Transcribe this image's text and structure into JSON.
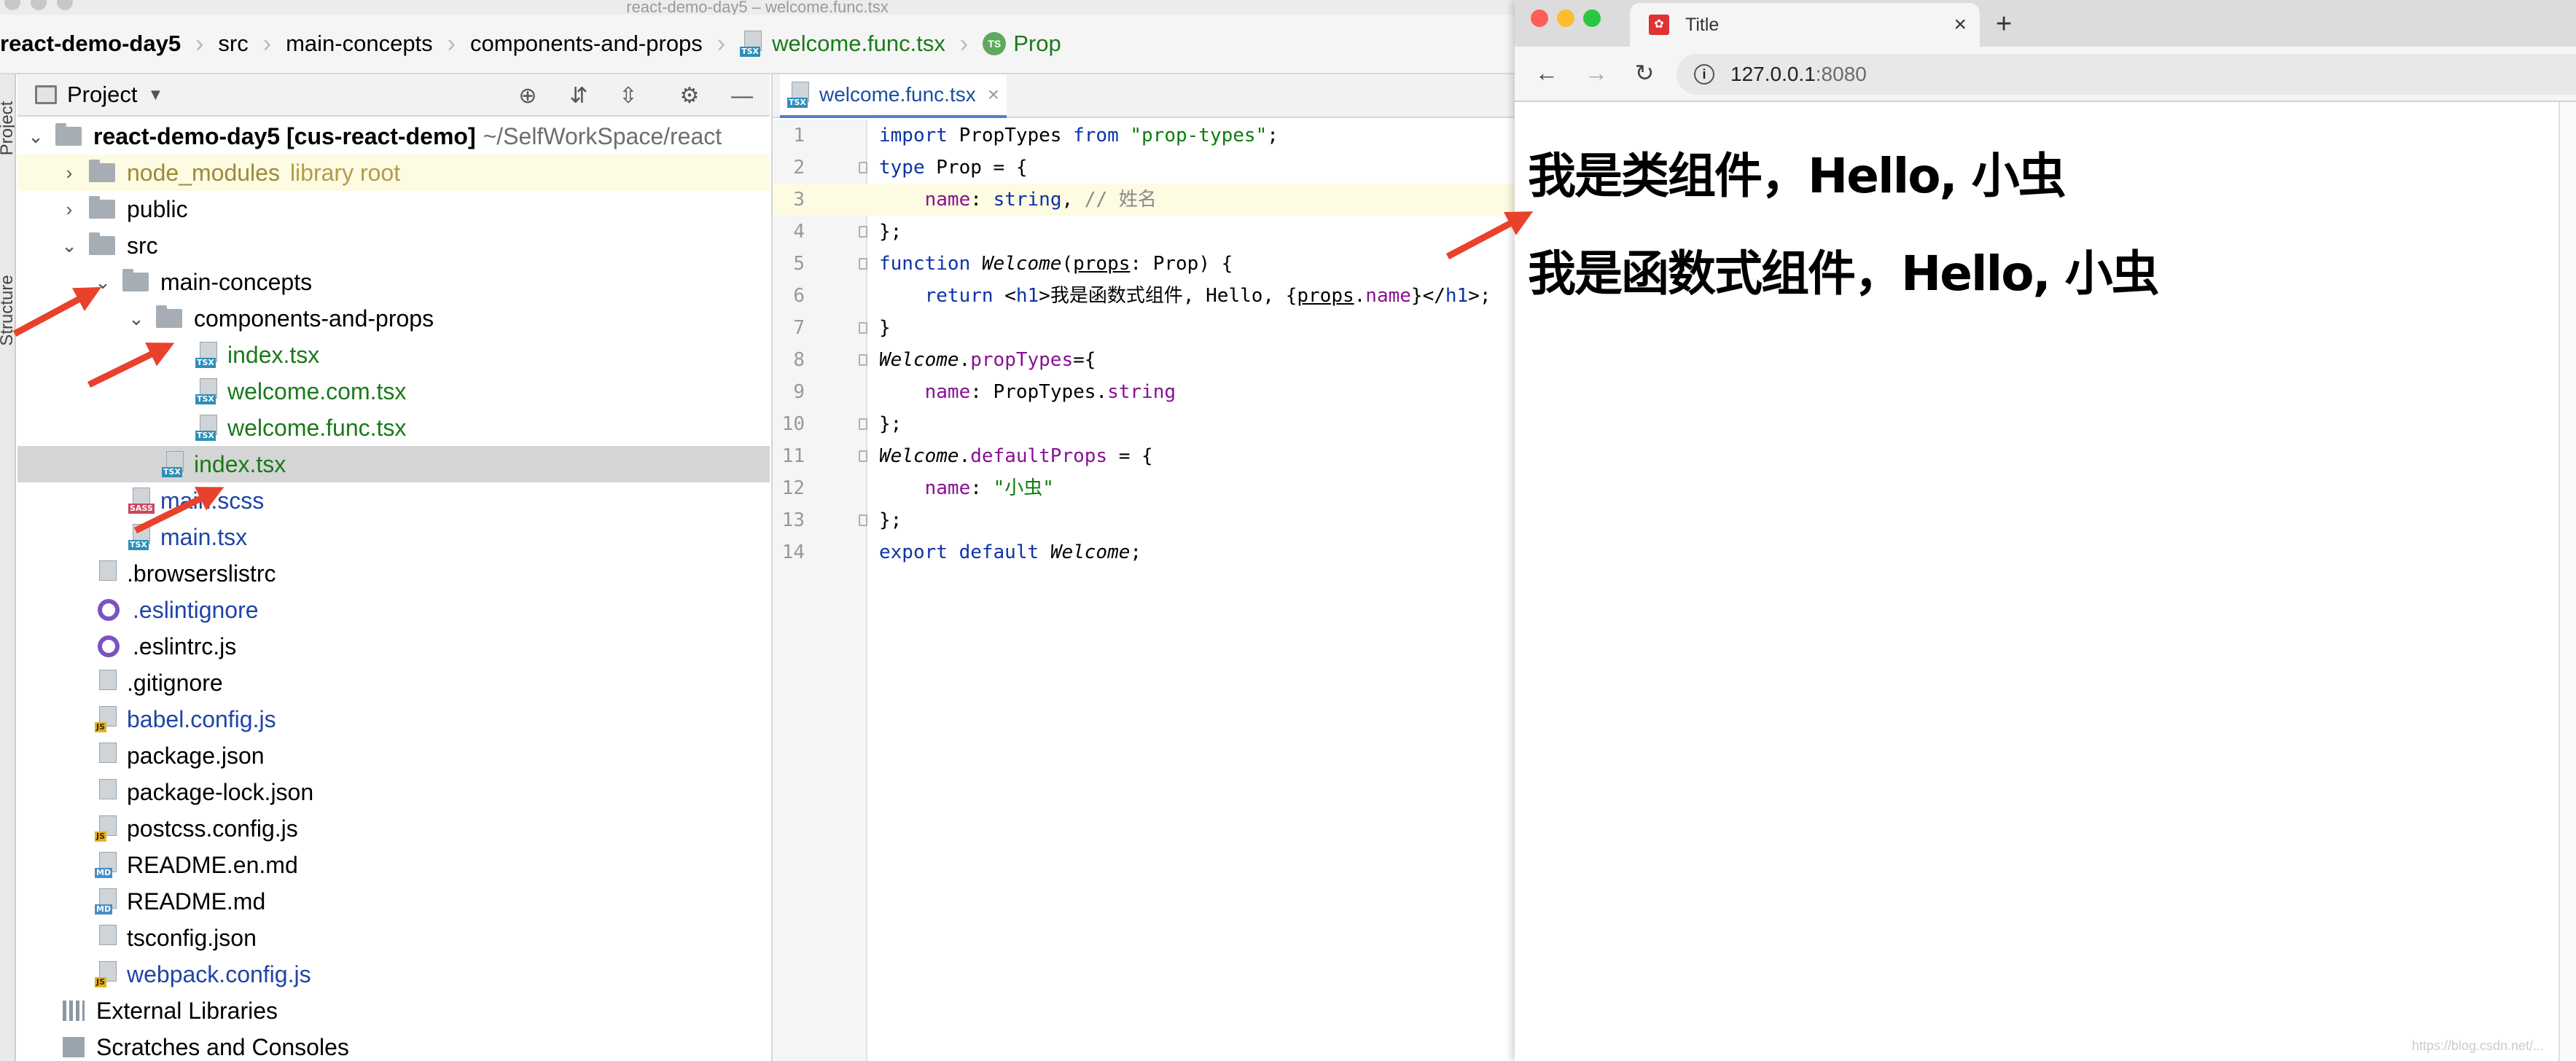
{
  "ide": {
    "window_title": "react-demo-day5 – welcome.func.tsx",
    "breadcrumb": [
      "react-demo-day5",
      "src",
      "main-concepts",
      "components-and-props",
      "welcome.func.tsx",
      "Prop"
    ],
    "side_labels": [
      "Project",
      "Structure"
    ],
    "project_panel": {
      "title": "Project",
      "tree": [
        {
          "label": "react-demo-day5",
          "suffix": "[cus-react-demo]",
          "path": "~/SelfWorkSpace/react",
          "type": "folder",
          "depth": 0,
          "expanded": true
        },
        {
          "label": "node_modules",
          "extra": "library root",
          "type": "folder",
          "depth": 1,
          "expanded": false
        },
        {
          "label": "public",
          "type": "folder",
          "depth": 1,
          "expanded": false
        },
        {
          "label": "src",
          "type": "folder",
          "depth": 1,
          "expanded": true
        },
        {
          "label": "main-concepts",
          "type": "folder",
          "depth": 2,
          "expanded": true
        },
        {
          "label": "components-and-props",
          "type": "folder",
          "depth": 3,
          "expanded": true
        },
        {
          "label": "index.tsx",
          "type": "tsx",
          "depth": 4
        },
        {
          "label": "welcome.com.tsx",
          "type": "tsx",
          "depth": 4
        },
        {
          "label": "welcome.func.tsx",
          "type": "tsx",
          "depth": 4
        },
        {
          "label": "index.tsx",
          "type": "tsx",
          "depth": 3,
          "selected": true
        },
        {
          "label": "main.scss",
          "type": "sass",
          "depth": 2
        },
        {
          "label": "main.tsx",
          "type": "tsx",
          "depth": 2
        },
        {
          "label": ".browserslistrc",
          "type": "text",
          "depth": 1
        },
        {
          "label": ".eslintignore",
          "type": "eslint",
          "depth": 1
        },
        {
          "label": ".eslintrc.js",
          "type": "eslint",
          "depth": 1
        },
        {
          "label": ".gitignore",
          "type": "text",
          "depth": 1
        },
        {
          "label": "babel.config.js",
          "type": "js",
          "depth": 1
        },
        {
          "label": "package.json",
          "type": "json",
          "depth": 1
        },
        {
          "label": "package-lock.json",
          "type": "json",
          "depth": 1
        },
        {
          "label": "postcss.config.js",
          "type": "js",
          "depth": 1
        },
        {
          "label": "README.en.md",
          "type": "md",
          "depth": 1
        },
        {
          "label": "README.md",
          "type": "md",
          "depth": 1
        },
        {
          "label": "tsconfig.json",
          "type": "json",
          "depth": 1
        },
        {
          "label": "webpack.config.js",
          "type": "js",
          "depth": 1
        },
        {
          "label": "External Libraries",
          "type": "lib",
          "depth": 0
        },
        {
          "label": "Scratches and Consoles",
          "type": "scratch",
          "depth": 0
        }
      ]
    },
    "editor": {
      "tab_label": "welcome.func.tsx",
      "lines": [
        "import PropTypes from \"prop-types\";",
        "type Prop = {",
        "    name: string, // 姓名",
        "};",
        "function Welcome(props: Prop) {",
        "    return <h1>我是函数式组件, Hello, {props.name}</h1>;",
        "}",
        "Welcome.propTypes={",
        "    name: PropTypes.string",
        "};",
        "Welcome.defaultProps = {",
        "    name: \"小虫\"",
        "};",
        "export default Welcome;"
      ]
    }
  },
  "browser": {
    "tab_title": "Title",
    "url_host": "127.0.0.1",
    "url_port": ":8080",
    "headings": [
      "我是类组件，Hello, 小虫",
      "我是函数式组件，Hello, 小虫"
    ],
    "watermark": "https://blog.csdn.net/..."
  },
  "colors": {
    "annotation_arrow": "#e8412c",
    "selected_row": "#d5d5d5"
  }
}
